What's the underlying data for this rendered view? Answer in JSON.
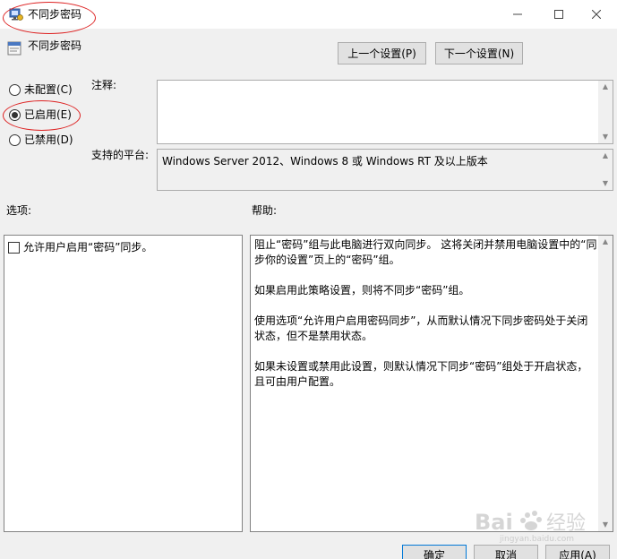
{
  "window": {
    "title": "不同步密码",
    "icon": "group-policy-icon",
    "controls": {
      "minimize": "minimize-icon",
      "maximize": "maximize-icon",
      "close": "close-icon"
    }
  },
  "policy": {
    "name": "不同步密码",
    "icon": "policy-setting-icon"
  },
  "navigation": {
    "prev_label": "上一个设置(P)",
    "next_label": "下一个设置(N)"
  },
  "state_options": [
    {
      "label": "未配置(C)",
      "checked": false
    },
    {
      "label": "已启用(E)",
      "checked": true
    },
    {
      "label": "已禁用(D)",
      "checked": false
    }
  ],
  "comment": {
    "label": "注释:",
    "value": ""
  },
  "platform": {
    "label": "支持的平台:",
    "value": "Windows Server 2012、Windows 8 或 Windows RT 及以上版本"
  },
  "options": {
    "label": "选项:",
    "checkbox_label": "允许用户启用“密码”同步。",
    "checkbox_checked": false
  },
  "help": {
    "label": "帮助:",
    "paragraphs": [
      "阻止“密码”组与此电脑进行双向同步。 这将关闭并禁用电脑设置中的“同步你的设置”页上的“密码”组。",
      "如果启用此策略设置，则将不同步“密码”组。",
      "使用选项“允许用户启用密码同步”，从而默认情况下同步密码处于关闭状态，但不是禁用状态。",
      "如果未设置或禁用此设置，则默认情况下同步“密码”组处于开启状态，且可由用户配置。"
    ]
  },
  "footer": {
    "ok_label": "确定",
    "cancel_label": "取消",
    "apply_label": "应用(A)"
  },
  "annotations": {
    "color": "#dd2222"
  }
}
